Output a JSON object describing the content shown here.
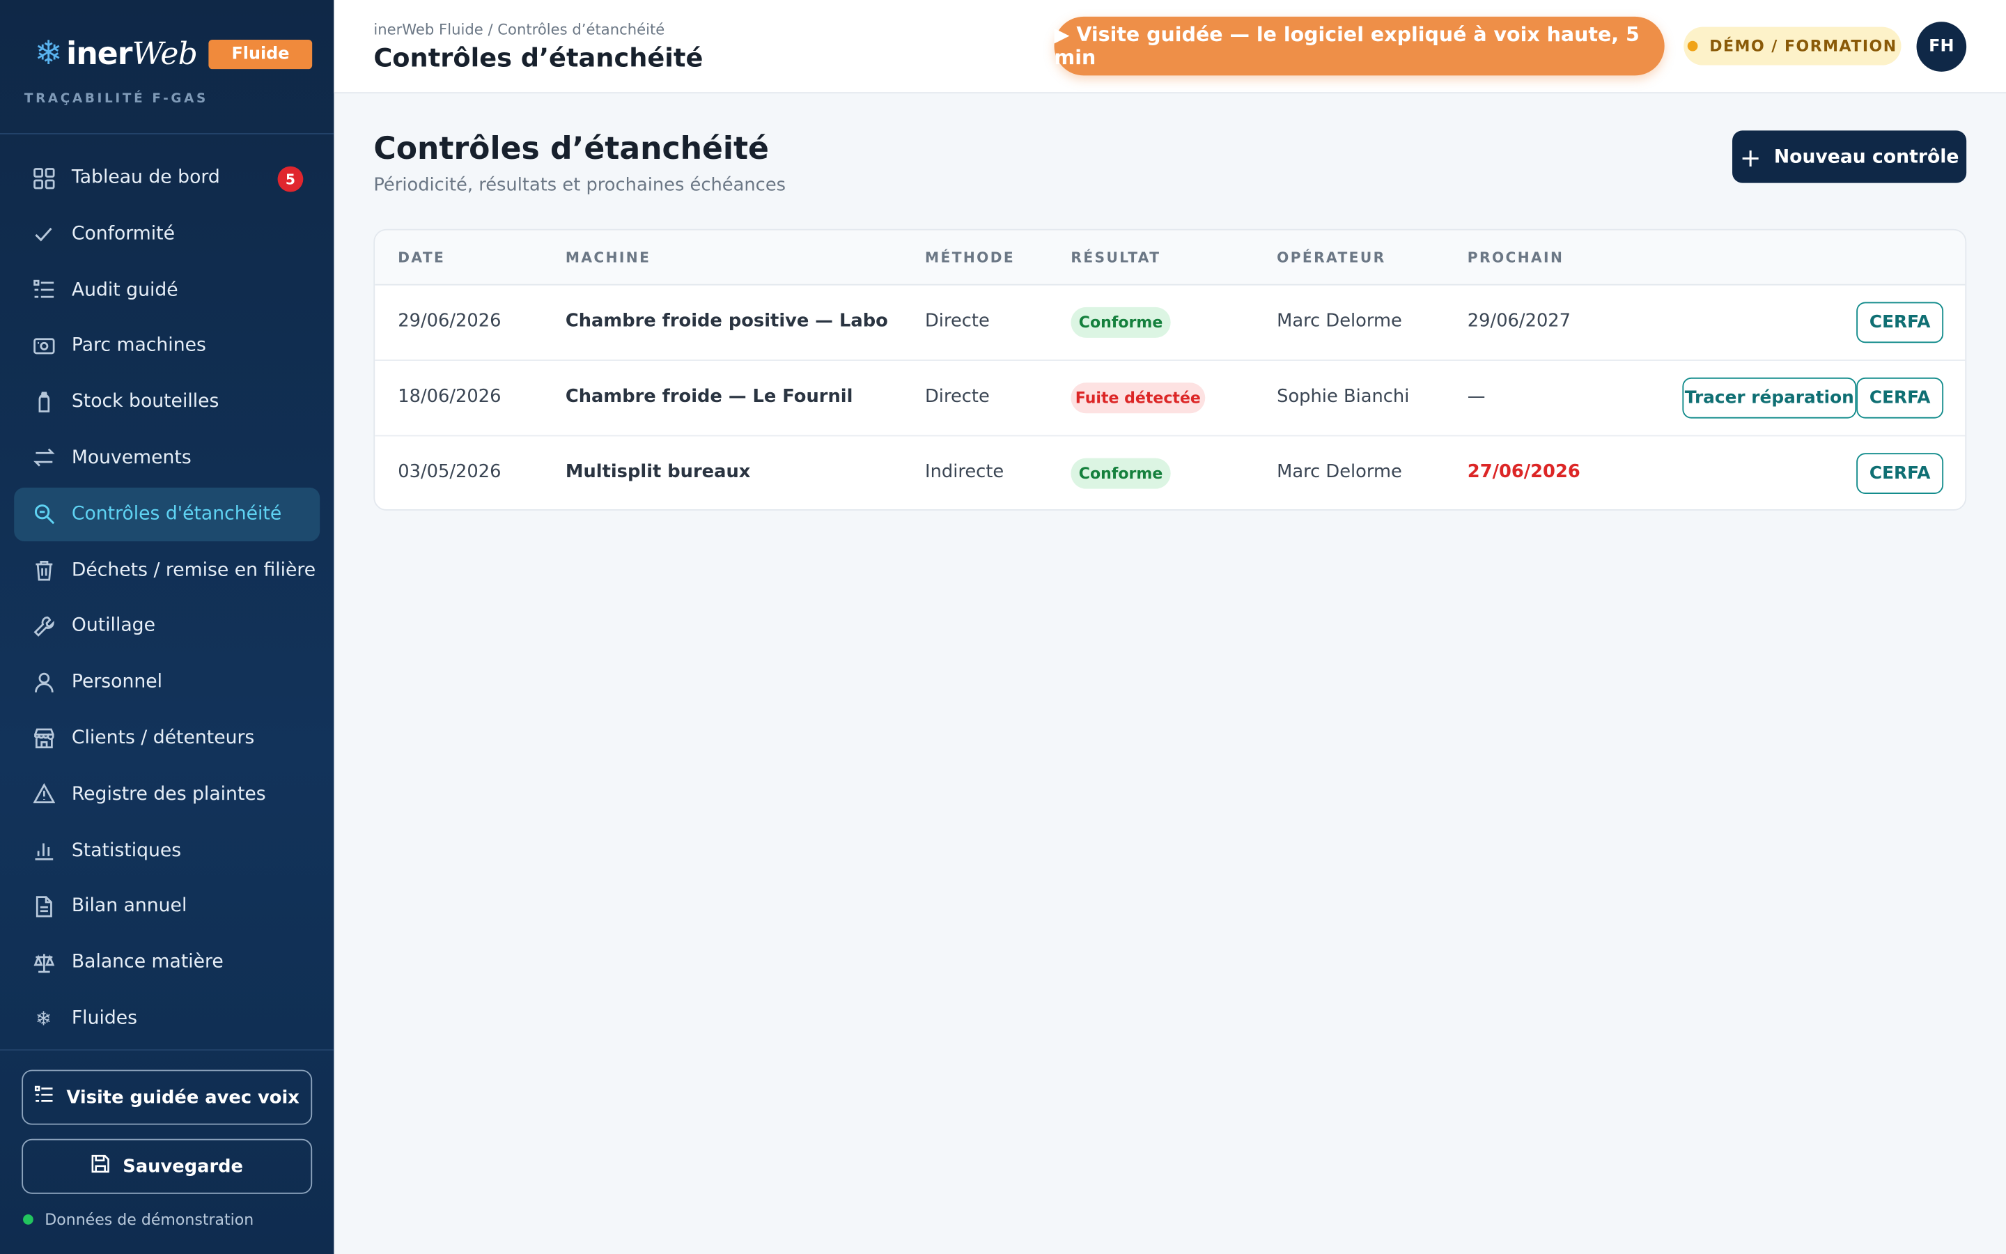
{
  "brand": {
    "name_a": "iner",
    "name_b": "Web",
    "product": "Fluide",
    "tagline": "TRAÇABILITÉ F-GAS",
    "logo_icon": "snowflake-icon"
  },
  "sidebar": {
    "items": [
      {
        "label": "Tableau de bord",
        "icon": "grid-icon",
        "badge": "5"
      },
      {
        "label": "Conformité",
        "icon": "check-icon"
      },
      {
        "label": "Audit guidé",
        "icon": "list-icon"
      },
      {
        "label": "Parc machines",
        "icon": "machine-icon"
      },
      {
        "label": "Stock bouteilles",
        "icon": "bottle-icon"
      },
      {
        "label": "Mouvements",
        "icon": "arrows-icon"
      },
      {
        "label": "Contrôles d'étanchéité",
        "icon": "search-icon",
        "active": true
      },
      {
        "label": "Déchets / remise en filière",
        "icon": "trash-icon"
      },
      {
        "label": "Outillage",
        "icon": "wrench-icon"
      },
      {
        "label": "Personnel",
        "icon": "user-icon"
      },
      {
        "label": "Clients / détenteurs",
        "icon": "store-icon"
      },
      {
        "label": "Registre des plaintes",
        "icon": "warning-icon"
      },
      {
        "label": "Statistiques",
        "icon": "chart-icon"
      },
      {
        "label": "Bilan annuel",
        "icon": "document-icon"
      },
      {
        "label": "Balance matière",
        "icon": "scale-icon"
      },
      {
        "label": "Fluides",
        "icon": "snowflake-icon"
      }
    ],
    "guided_tour_label": "Visite guidée avec voix",
    "backup_label": "Sauvegarde",
    "demo_status": "Données de démonstration"
  },
  "header": {
    "breadcrumb": "inerWeb Fluide / Contrôles d’étanchéité",
    "title": "Contrôles d’étanchéité",
    "tour_button": "▶ Visite guidée — le logiciel expliqué à voix haute, 5 min",
    "demo_tag": "DÉMO / FORMATION",
    "avatar": "FH"
  },
  "page": {
    "title": "Contrôles d’étanchéité",
    "subtitle": "Périodicité, résultats et prochaines échéances",
    "new_button": "Nouveau contrôle"
  },
  "table": {
    "columns": [
      "DATE",
      "MACHINE",
      "MÉTHODE",
      "RÉSULTAT",
      "OPÉRATEUR",
      "PROCHAIN"
    ],
    "rows": [
      {
        "date": "29/06/2026",
        "machine": "Chambre froide positive — Labo",
        "method": "Directe",
        "result": "Conforme",
        "operator": "Marc Delorme",
        "next": "29/06/2027",
        "cerfa": "CERFA"
      },
      {
        "date": "18/06/2026",
        "machine": "Chambre froide — Le Fournil",
        "method": "Directe",
        "result": "Fuite détectée",
        "operator": "Sophie Bianchi",
        "next": "—",
        "repair": "Tracer réparation",
        "cerfa": "CERFA"
      },
      {
        "date": "03/05/2026",
        "machine": "Multisplit bureaux",
        "method": "Indirecte",
        "result": "Conforme",
        "operator": "Marc Delorme",
        "next": "27/06/2026",
        "cerfa": "CERFA"
      }
    ]
  },
  "colors": {
    "sidebar": "#0f2847",
    "accent": "#5fd3f3",
    "orange": "#ee8f48",
    "ok": "#15803d",
    "leak": "#dc2626"
  }
}
